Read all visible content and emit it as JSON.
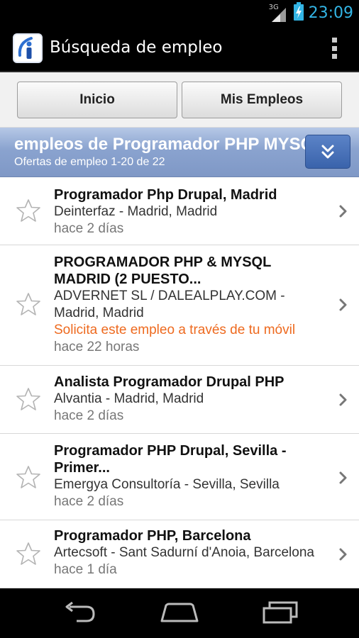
{
  "statusbar": {
    "network": "3G",
    "time": "23:09"
  },
  "appbar": {
    "title": "Búsqueda de empleo"
  },
  "nav": {
    "inicio": "Inicio",
    "mis_empleos": "Mis Empleos"
  },
  "results": {
    "title": "empleos de Programador PHP MYSQL",
    "subtitle": "Ofertas de empleo 1-20 de 22"
  },
  "jobs": [
    {
      "title": "Programador Php Drupal, Madrid",
      "company": "Deinterfaz -  Madrid, Madrid",
      "age": "hace 2 días"
    },
    {
      "title_line1": "PROGRAMADOR PHP & MYSQL",
      "title_line2": "MADRID (2 PUESTO...",
      "company_line1": "ADVERNET SL / DALEALPLAY.COM -",
      "company_line2": "Madrid, Madrid",
      "apply": "Solicita este empleo a través de tu móvil",
      "age": "hace 22 horas"
    },
    {
      "title": "Analista Programador Drupal PHP",
      "company": "Alvantia -  Madrid, Madrid",
      "age": "hace 2 días"
    },
    {
      "title_line1": "Programador PHP Drupal, Sevilla -",
      "title_line2": "Primer...",
      "company": "Emergya Consultoría -  Sevilla, Sevilla",
      "age": "hace 2 días"
    },
    {
      "title": "Programador PHP, Barcelona",
      "company": "Artecsoft -  Sant Sadurní d'Anoia, Barcelona",
      "age": "hace 1 día"
    }
  ],
  "colors": {
    "accent_time": "#33b5e5",
    "apply_text": "#ee6a1f",
    "header_blue": "#8aa3cf"
  }
}
